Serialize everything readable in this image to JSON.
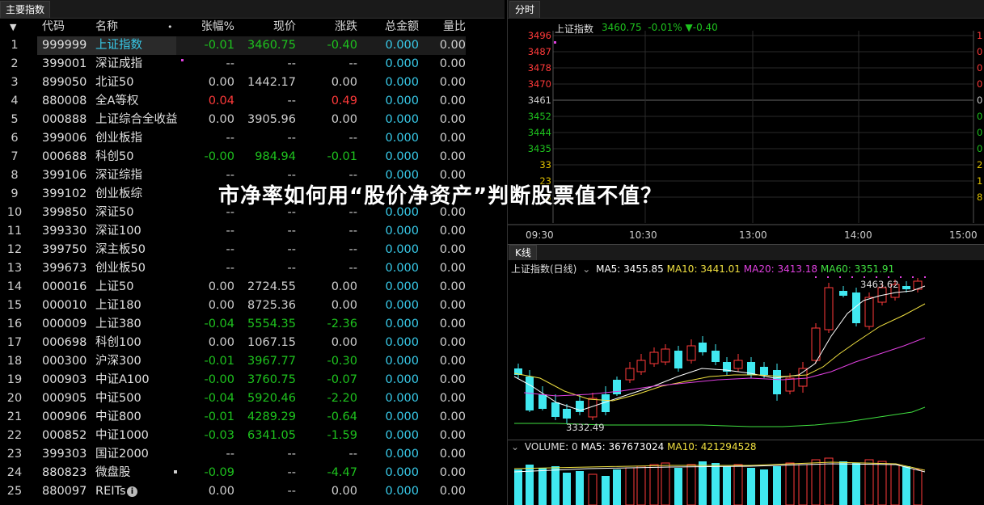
{
  "left_panel": {
    "tab": "主要指数",
    "headers": {
      "sort": "▼",
      "code": "代码",
      "name": "名称",
      "dot": "•",
      "pct": "张幅%",
      "price": "现价",
      "chg": "涨跌",
      "amount": "总金额",
      "volratio": "量比"
    },
    "rows": [
      {
        "no": "1",
        "code": "999999",
        "name": "上证指数",
        "pct": "-0.01",
        "price": "3460.75",
        "chg": "-0.40",
        "amount": "0.000",
        "vr": "0.00",
        "pc": "g",
        "prc": "g",
        "cc": "g"
      },
      {
        "no": "2",
        "code": "399001",
        "name": "深证成指",
        "pct": "--",
        "price": "--",
        "chg": "--",
        "amount": "0.000",
        "vr": "0.00",
        "pc": "w",
        "prc": "w",
        "cc": "w"
      },
      {
        "no": "3",
        "code": "899050",
        "name": "北证50",
        "pct": "0.00",
        "price": "1442.17",
        "chg": "0.00",
        "amount": "0.000",
        "vr": "0.00",
        "pc": "w",
        "prc": "w",
        "cc": "w"
      },
      {
        "no": "4",
        "code": "880008",
        "name": "全A等权",
        "pct": "0.04",
        "price": "--",
        "chg": "0.49",
        "amount": "0.000",
        "vr": "0.00",
        "pc": "r",
        "prc": "w",
        "cc": "r"
      },
      {
        "no": "5",
        "code": "000888",
        "name": "上证综合全收益",
        "pct": "0.00",
        "price": "3905.96",
        "chg": "0.00",
        "amount": "0.000",
        "vr": "0.00",
        "pc": "w",
        "prc": "w",
        "cc": "w"
      },
      {
        "no": "6",
        "code": "399006",
        "name": "创业板指",
        "pct": "--",
        "price": "--",
        "chg": "--",
        "amount": "0.000",
        "vr": "0.00",
        "pc": "w",
        "prc": "w",
        "cc": "w"
      },
      {
        "no": "7",
        "code": "000688",
        "name": "科创50",
        "pct": "-0.00",
        "price": "984.94",
        "chg": "-0.01",
        "amount": "0.000",
        "vr": "0.00",
        "pc": "g",
        "prc": "g",
        "cc": "g"
      },
      {
        "no": "8",
        "code": "399106",
        "name": "深证综指",
        "pct": "--",
        "price": "--",
        "chg": "--",
        "amount": "0.000",
        "vr": "0.00",
        "pc": "w",
        "prc": "w",
        "cc": "w"
      },
      {
        "no": "9",
        "code": "399102",
        "name": "创业板综",
        "pct": "",
        "price": "",
        "chg": "",
        "amount": "",
        "vr": "",
        "pc": "w",
        "prc": "w",
        "cc": "w"
      },
      {
        "no": "10",
        "code": "399850",
        "name": "深证50",
        "pct": "--",
        "price": "--",
        "chg": "--",
        "amount": "0.000",
        "vr": "0.00",
        "pc": "w",
        "prc": "w",
        "cc": "w"
      },
      {
        "no": "11",
        "code": "399330",
        "name": "深证100",
        "pct": "--",
        "price": "--",
        "chg": "--",
        "amount": "0.000",
        "vr": "0.00",
        "pc": "w",
        "prc": "w",
        "cc": "w"
      },
      {
        "no": "12",
        "code": "399750",
        "name": "深主板50",
        "pct": "--",
        "price": "--",
        "chg": "--",
        "amount": "0.000",
        "vr": "0.00",
        "pc": "w",
        "prc": "w",
        "cc": "w"
      },
      {
        "no": "13",
        "code": "399673",
        "name": "创业板50",
        "pct": "--",
        "price": "--",
        "chg": "--",
        "amount": "0.000",
        "vr": "0.00",
        "pc": "w",
        "prc": "w",
        "cc": "w"
      },
      {
        "no": "14",
        "code": "000016",
        "name": "上证50",
        "pct": "0.00",
        "price": "2724.55",
        "chg": "0.00",
        "amount": "0.000",
        "vr": "0.00",
        "pc": "w",
        "prc": "w",
        "cc": "w"
      },
      {
        "no": "15",
        "code": "000010",
        "name": "上证180",
        "pct": "0.00",
        "price": "8725.36",
        "chg": "0.00",
        "amount": "0.000",
        "vr": "0.00",
        "pc": "w",
        "prc": "w",
        "cc": "w"
      },
      {
        "no": "16",
        "code": "000009",
        "name": "上证380",
        "pct": "-0.04",
        "price": "5554.35",
        "chg": "-2.36",
        "amount": "0.000",
        "vr": "0.00",
        "pc": "g",
        "prc": "g",
        "cc": "g"
      },
      {
        "no": "17",
        "code": "000698",
        "name": "科创100",
        "pct": "0.00",
        "price": "1067.15",
        "chg": "0.00",
        "amount": "0.000",
        "vr": "0.00",
        "pc": "w",
        "prc": "w",
        "cc": "w"
      },
      {
        "no": "18",
        "code": "000300",
        "name": "沪深300",
        "pct": "-0.01",
        "price": "3967.77",
        "chg": "-0.30",
        "amount": "0.000",
        "vr": "0.00",
        "pc": "g",
        "prc": "g",
        "cc": "g"
      },
      {
        "no": "19",
        "code": "000903",
        "name": "中证A100",
        "pct": "-0.00",
        "price": "3760.75",
        "chg": "-0.07",
        "amount": "0.000",
        "vr": "0.00",
        "pc": "g",
        "prc": "g",
        "cc": "g"
      },
      {
        "no": "20",
        "code": "000905",
        "name": "中证500",
        "pct": "-0.04",
        "price": "5920.46",
        "chg": "-2.20",
        "amount": "0.000",
        "vr": "0.00",
        "pc": "g",
        "prc": "g",
        "cc": "g"
      },
      {
        "no": "21",
        "code": "000906",
        "name": "中证800",
        "pct": "-0.01",
        "price": "4289.29",
        "chg": "-0.64",
        "amount": "0.000",
        "vr": "0.00",
        "pc": "g",
        "prc": "g",
        "cc": "g"
      },
      {
        "no": "22",
        "code": "000852",
        "name": "中证1000",
        "pct": "-0.03",
        "price": "6341.05",
        "chg": "-1.59",
        "amount": "0.000",
        "vr": "0.00",
        "pc": "g",
        "prc": "g",
        "cc": "g"
      },
      {
        "no": "23",
        "code": "399303",
        "name": "国证2000",
        "pct": "--",
        "price": "--",
        "chg": "--",
        "amount": "0.000",
        "vr": "0.00",
        "pc": "w",
        "prc": "w",
        "cc": "w"
      },
      {
        "no": "24",
        "code": "880823",
        "name": "微盘股",
        "pct": "-0.09",
        "price": "--",
        "chg": "-4.47",
        "amount": "0.000",
        "vr": "0.00",
        "pc": "g",
        "prc": "w",
        "cc": "g"
      },
      {
        "no": "25",
        "code": "880097",
        "name": "REITs",
        "pct": "0.00",
        "price": "--",
        "chg": "0.00",
        "amount": "0.000",
        "vr": "0.00",
        "pc": "w",
        "prc": "w",
        "cc": "w"
      }
    ]
  },
  "banner": "市净率如何用“股价净资产”判断股票值不值？",
  "intraday": {
    "tab": "分时",
    "legend_name": "上证指数",
    "legend_values": "3460.75  -0.01% ▼-0.40",
    "left_axis": [
      "3496",
      "3487",
      "3478",
      "3470",
      "3461",
      "3452",
      "3444",
      "3435",
      "33",
      "23",
      "8"
    ],
    "left_axis_colors": [
      "#ff3a3a",
      "#ff3a3a",
      "#ff3a3a",
      "#ff3a3a",
      "#cfcfcf",
      "#1ec31e",
      "#1ec31e",
      "#1ec31e",
      "#e0c000",
      "#e0c000",
      "#e0c000"
    ],
    "right_axis": [
      "1",
      "0",
      "0",
      "0",
      "0",
      "0",
      "0",
      "0",
      "2",
      "1",
      "8"
    ],
    "times": [
      "09:30",
      "10:30",
      "13:00",
      "14:00",
      "15:00"
    ]
  },
  "kline": {
    "tab": "K线",
    "title": "上证指数(日线)",
    "ma5": "MA5: 3455.85",
    "ma10": "MA10: 3441.01",
    "ma20": "MA20: 3413.18",
    "ma60": "MA60: 3351.91",
    "high_label": "3463.62",
    "low_label": "3332.49",
    "colors": {
      "ma5": "#ffffff",
      "ma10": "#f0e040",
      "ma20": "#e040e0",
      "ma60": "#40e040",
      "up": "#ff3a3a",
      "down": "#40e8f0"
    }
  },
  "volume": {
    "label": "VOLUME: 0",
    "ma5": "MA5: 367673024",
    "ma10": "MA10: 421294528"
  }
}
